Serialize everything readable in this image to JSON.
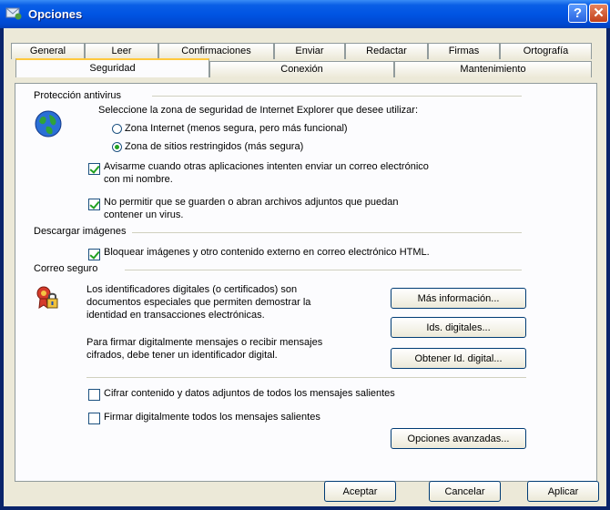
{
  "window": {
    "title": "Opciones"
  },
  "tabs_row1": [
    "General",
    "Leer",
    "Confirmaciones",
    "Enviar",
    "Redactar",
    "Firmas",
    "Ortografía"
  ],
  "tabs_row2": [
    "Seguridad",
    "Conexión",
    "Mantenimiento"
  ],
  "active_tab": "Seguridad",
  "antivirus": {
    "section": "Protección antivirus",
    "zone_prompt": "Seleccione la zona de seguridad de Internet Explorer que desee utilizar:",
    "radio_internet": "Zona Internet (menos segura, pero más funcional)",
    "radio_restricted": "Zona de sitios restringidos (más segura)",
    "selected_zone": "restricted",
    "warn_line1": "Avisarme cuando otras aplicaciones intenten enviar un correo electrónico",
    "warn_line2": "con mi nombre.",
    "warn_checked": true,
    "block_line1": "No permitir que se guarden o abran archivos adjuntos que puedan",
    "block_line2": "contener un virus.",
    "block_checked": true
  },
  "images": {
    "section": "Descargar imágenes",
    "block_external": "Bloquear imágenes y otro contenido externo en correo electrónico HTML.",
    "block_checked": true
  },
  "secure_mail": {
    "section": "Correo seguro",
    "para1_line1": "Los identificadores digitales (o certificados) son",
    "para1_line2": "documentos especiales que permiten demostrar la",
    "para1_line3": "identidad en transacciones electrónicas.",
    "para2_line1": "Para firmar digitalmente mensajes o recibir mensajes",
    "para2_line2": "cifrados, debe tener un identificador digital.",
    "more_info": "Más información...",
    "digital_ids": "Ids. digitales...",
    "get_id": "Obtener Id. digital...",
    "encrypt": "Cifrar contenido y datos adjuntos de todos los mensajes salientes",
    "encrypt_checked": false,
    "sign": "Firmar digitalmente todos los mensajes salientes",
    "sign_checked": false,
    "advanced": "Opciones avanzadas..."
  },
  "footer": {
    "ok": "Aceptar",
    "cancel": "Cancelar",
    "apply": "Aplicar"
  }
}
